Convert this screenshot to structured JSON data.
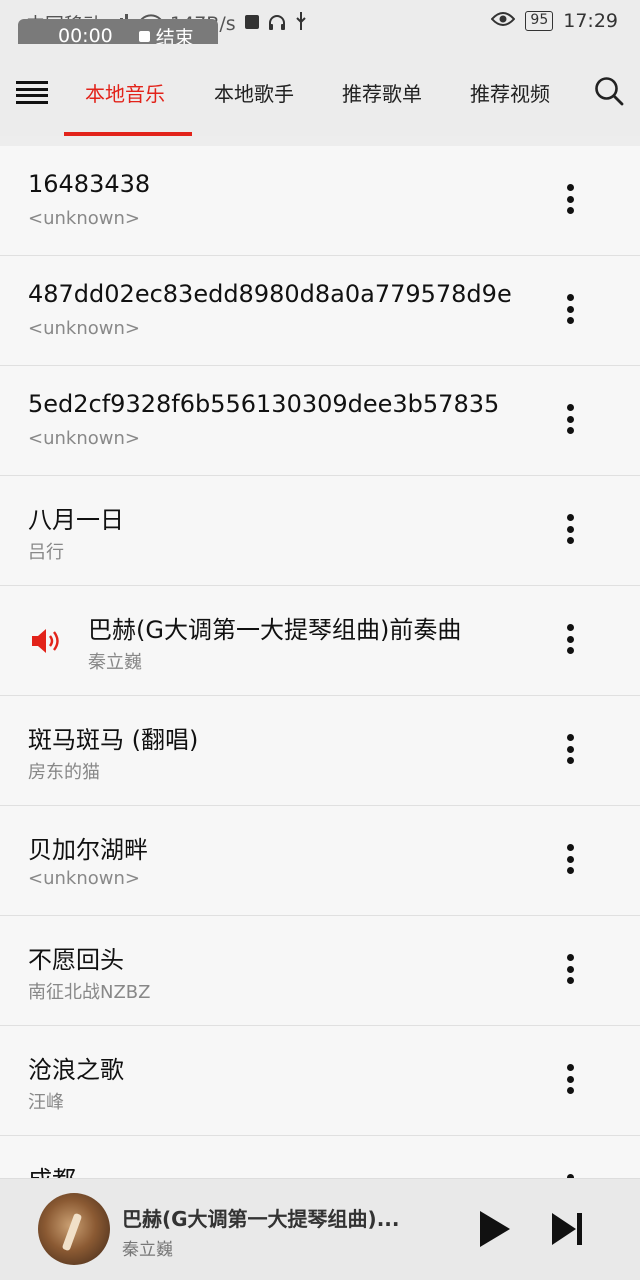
{
  "status_bar": {
    "carrier": "中国移动",
    "speed": "147B/s",
    "battery": "95",
    "time": "17:29"
  },
  "recording": {
    "time": "00:00",
    "stop_label": "结束"
  },
  "nav": {
    "tabs": [
      {
        "label": "本地音乐",
        "active": true
      },
      {
        "label": "本地歌手",
        "active": false
      },
      {
        "label": "推荐歌单",
        "active": false
      },
      {
        "label": "推荐视频",
        "active": false
      }
    ]
  },
  "songs": [
    {
      "title": "16483438",
      "artist": "<unknown>"
    },
    {
      "title": "487dd02ec83edd8980d8a0a779578d9e",
      "artist": "<unknown>"
    },
    {
      "title": "5ed2cf9328f6b556130309dee3b57835",
      "artist": "<unknown>"
    },
    {
      "title": "八月一日",
      "artist": "吕行"
    },
    {
      "title": "巴赫(G大调第一大提琴组曲)前奏曲",
      "artist": "秦立巍",
      "playing": true
    },
    {
      "title": "斑马斑马 (翻唱)",
      "artist": "房东的猫"
    },
    {
      "title": "贝加尔湖畔",
      "artist": "<unknown>"
    },
    {
      "title": "不愿回头",
      "artist": "南征北战NZBZ"
    },
    {
      "title": "沧浪之歌",
      "artist": "汪峰"
    },
    {
      "title": "成都",
      "artist": ""
    }
  ],
  "player": {
    "title": "巴赫(G大调第一大提琴组曲)...",
    "artist": "秦立巍"
  },
  "colors": {
    "accent": "#e2231a",
    "background": "#f7f7f7"
  },
  "icons": [
    "menu-icon",
    "search-icon",
    "speaker-icon",
    "more-vertical-icon",
    "play-icon",
    "next-track-icon"
  ]
}
